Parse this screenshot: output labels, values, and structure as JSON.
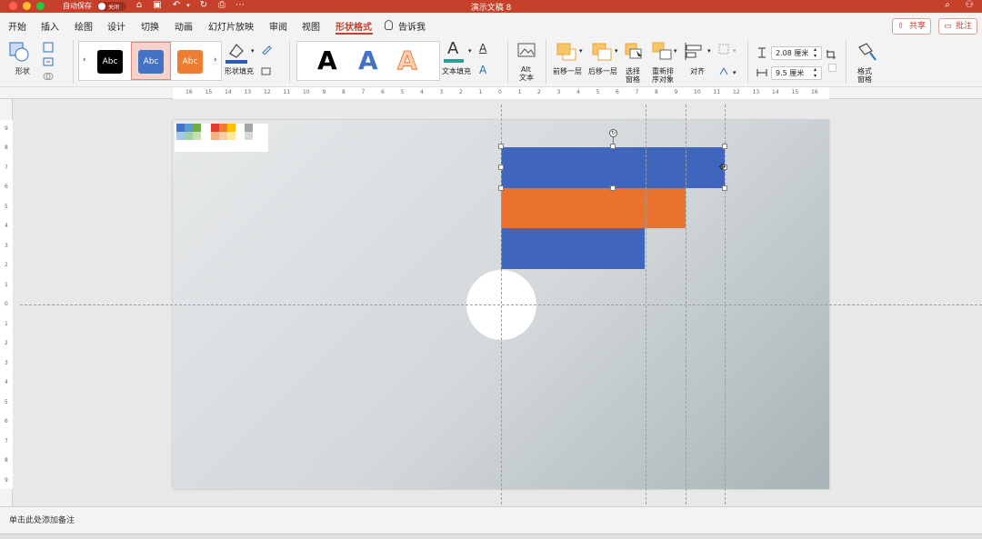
{
  "titlebar": {
    "autosave_label": "自动保存",
    "autosave_state": "关闭",
    "title": "演示文稿 8"
  },
  "menu": {
    "tabs": [
      "开始",
      "插入",
      "绘图",
      "设计",
      "切换",
      "动画",
      "幻灯片放映",
      "审阅",
      "视图",
      "形状格式"
    ],
    "active_tab": "形状格式",
    "tell_me": "告诉我",
    "share": "共享",
    "comments": "批注"
  },
  "ribbon": {
    "shapes_label": "形状",
    "shape_styles": [
      {
        "label": "Abc",
        "fill": "#000000"
      },
      {
        "label": "Abc",
        "fill": "#4472c4",
        "selected": true
      },
      {
        "label": "Abc",
        "fill": "#ed7d31"
      }
    ],
    "shape_fill_label": "形状填充",
    "wordart": [
      {
        "letter": "A",
        "color": "#000000"
      },
      {
        "letter": "A",
        "color": "#4472c4"
      },
      {
        "letter": "A",
        "color": "#ed7d31"
      }
    ],
    "text_fill_label": "文本填充",
    "alt_text_label_1": "Alt",
    "alt_text_label_2": "文本",
    "bring_forward": "前移一层",
    "send_backward": "后移一层",
    "selection_pane_1": "选择",
    "selection_pane_2": "窗格",
    "reorder_1": "重新排",
    "reorder_2": "序对象",
    "align": "对齐",
    "height_value": "2.08 厘米",
    "width_value": "9.5 厘米",
    "format_pane_1": "格式",
    "format_pane_2": "窗格"
  },
  "ruler": {
    "h_ticks": [
      "16",
      "15",
      "14",
      "13",
      "12",
      "11",
      "10",
      "9",
      "8",
      "7",
      "6",
      "5",
      "4",
      "3",
      "2",
      "1",
      "0",
      "1",
      "2",
      "3",
      "4",
      "5",
      "6",
      "7",
      "8",
      "9",
      "10",
      "11",
      "12",
      "13",
      "14",
      "15",
      "16"
    ],
    "v_ticks": [
      "9",
      "8",
      "7",
      "6",
      "5",
      "4",
      "3",
      "2",
      "1",
      "0",
      "1",
      "2",
      "3",
      "4",
      "5",
      "6",
      "7",
      "8",
      "9"
    ]
  },
  "slide": {
    "swatches": {
      "colors_a": [
        "#4472c4",
        "#5b9bd5",
        "#70ad47",
        "#a5c8e4",
        "#9fd0a6",
        "#c6e0b4"
      ],
      "colors_b": [
        "#e03c31",
        "#ed7d31",
        "#ffc000",
        "#f4b183",
        "#f8cbad",
        "#ffe699"
      ],
      "colors_c": [
        "#a5a5a5",
        "#d9d9d9"
      ]
    },
    "bars": [
      {
        "color": "#3f65bd",
        "selected": true
      },
      {
        "color": "#e9722f"
      },
      {
        "color": "#3f65bd"
      }
    ],
    "circle_color": "#ffffff",
    "selection_handle_color": "#7a7a7a"
  },
  "notes": {
    "placeholder": "单击此处添加备注"
  }
}
